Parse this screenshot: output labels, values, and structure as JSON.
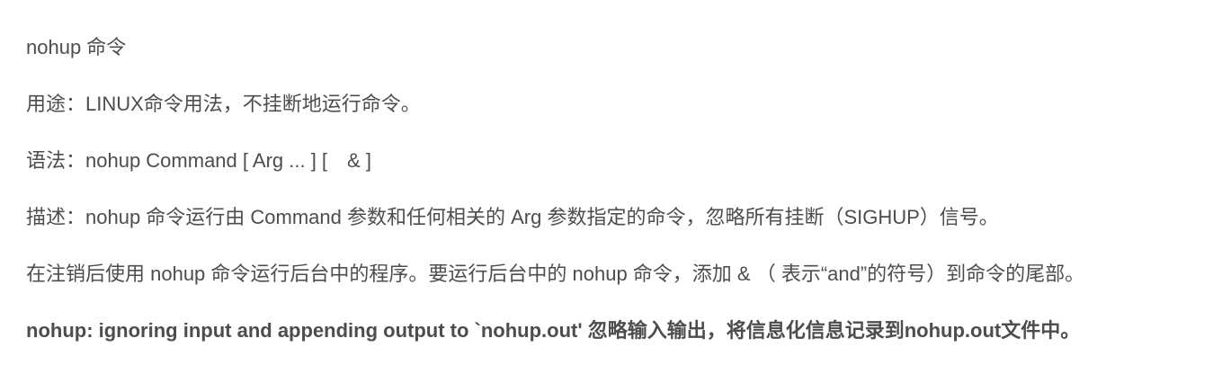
{
  "article": {
    "paragraphs": [
      "nohup 命令",
      "用途：LINUX命令用法，不挂断地运行命令。",
      "语法：nohup Command [ Arg ... ] [　& ]",
      "描述：nohup 命令运行由 Command 参数和任何相关的 Arg 参数指定的命令，忽略所有挂断（SIGHUP）信号。",
      "在注销后使用 nohup 命令运行后台中的程序。要运行后台中的 nohup 命令，添加 & （ 表示“and”的符号）到命令的尾部。",
      "nohup: ignoring input and appending output to `nohup.out'  忽略输入输出，将信息化信息记录到nohup.out文件中。"
    ]
  }
}
